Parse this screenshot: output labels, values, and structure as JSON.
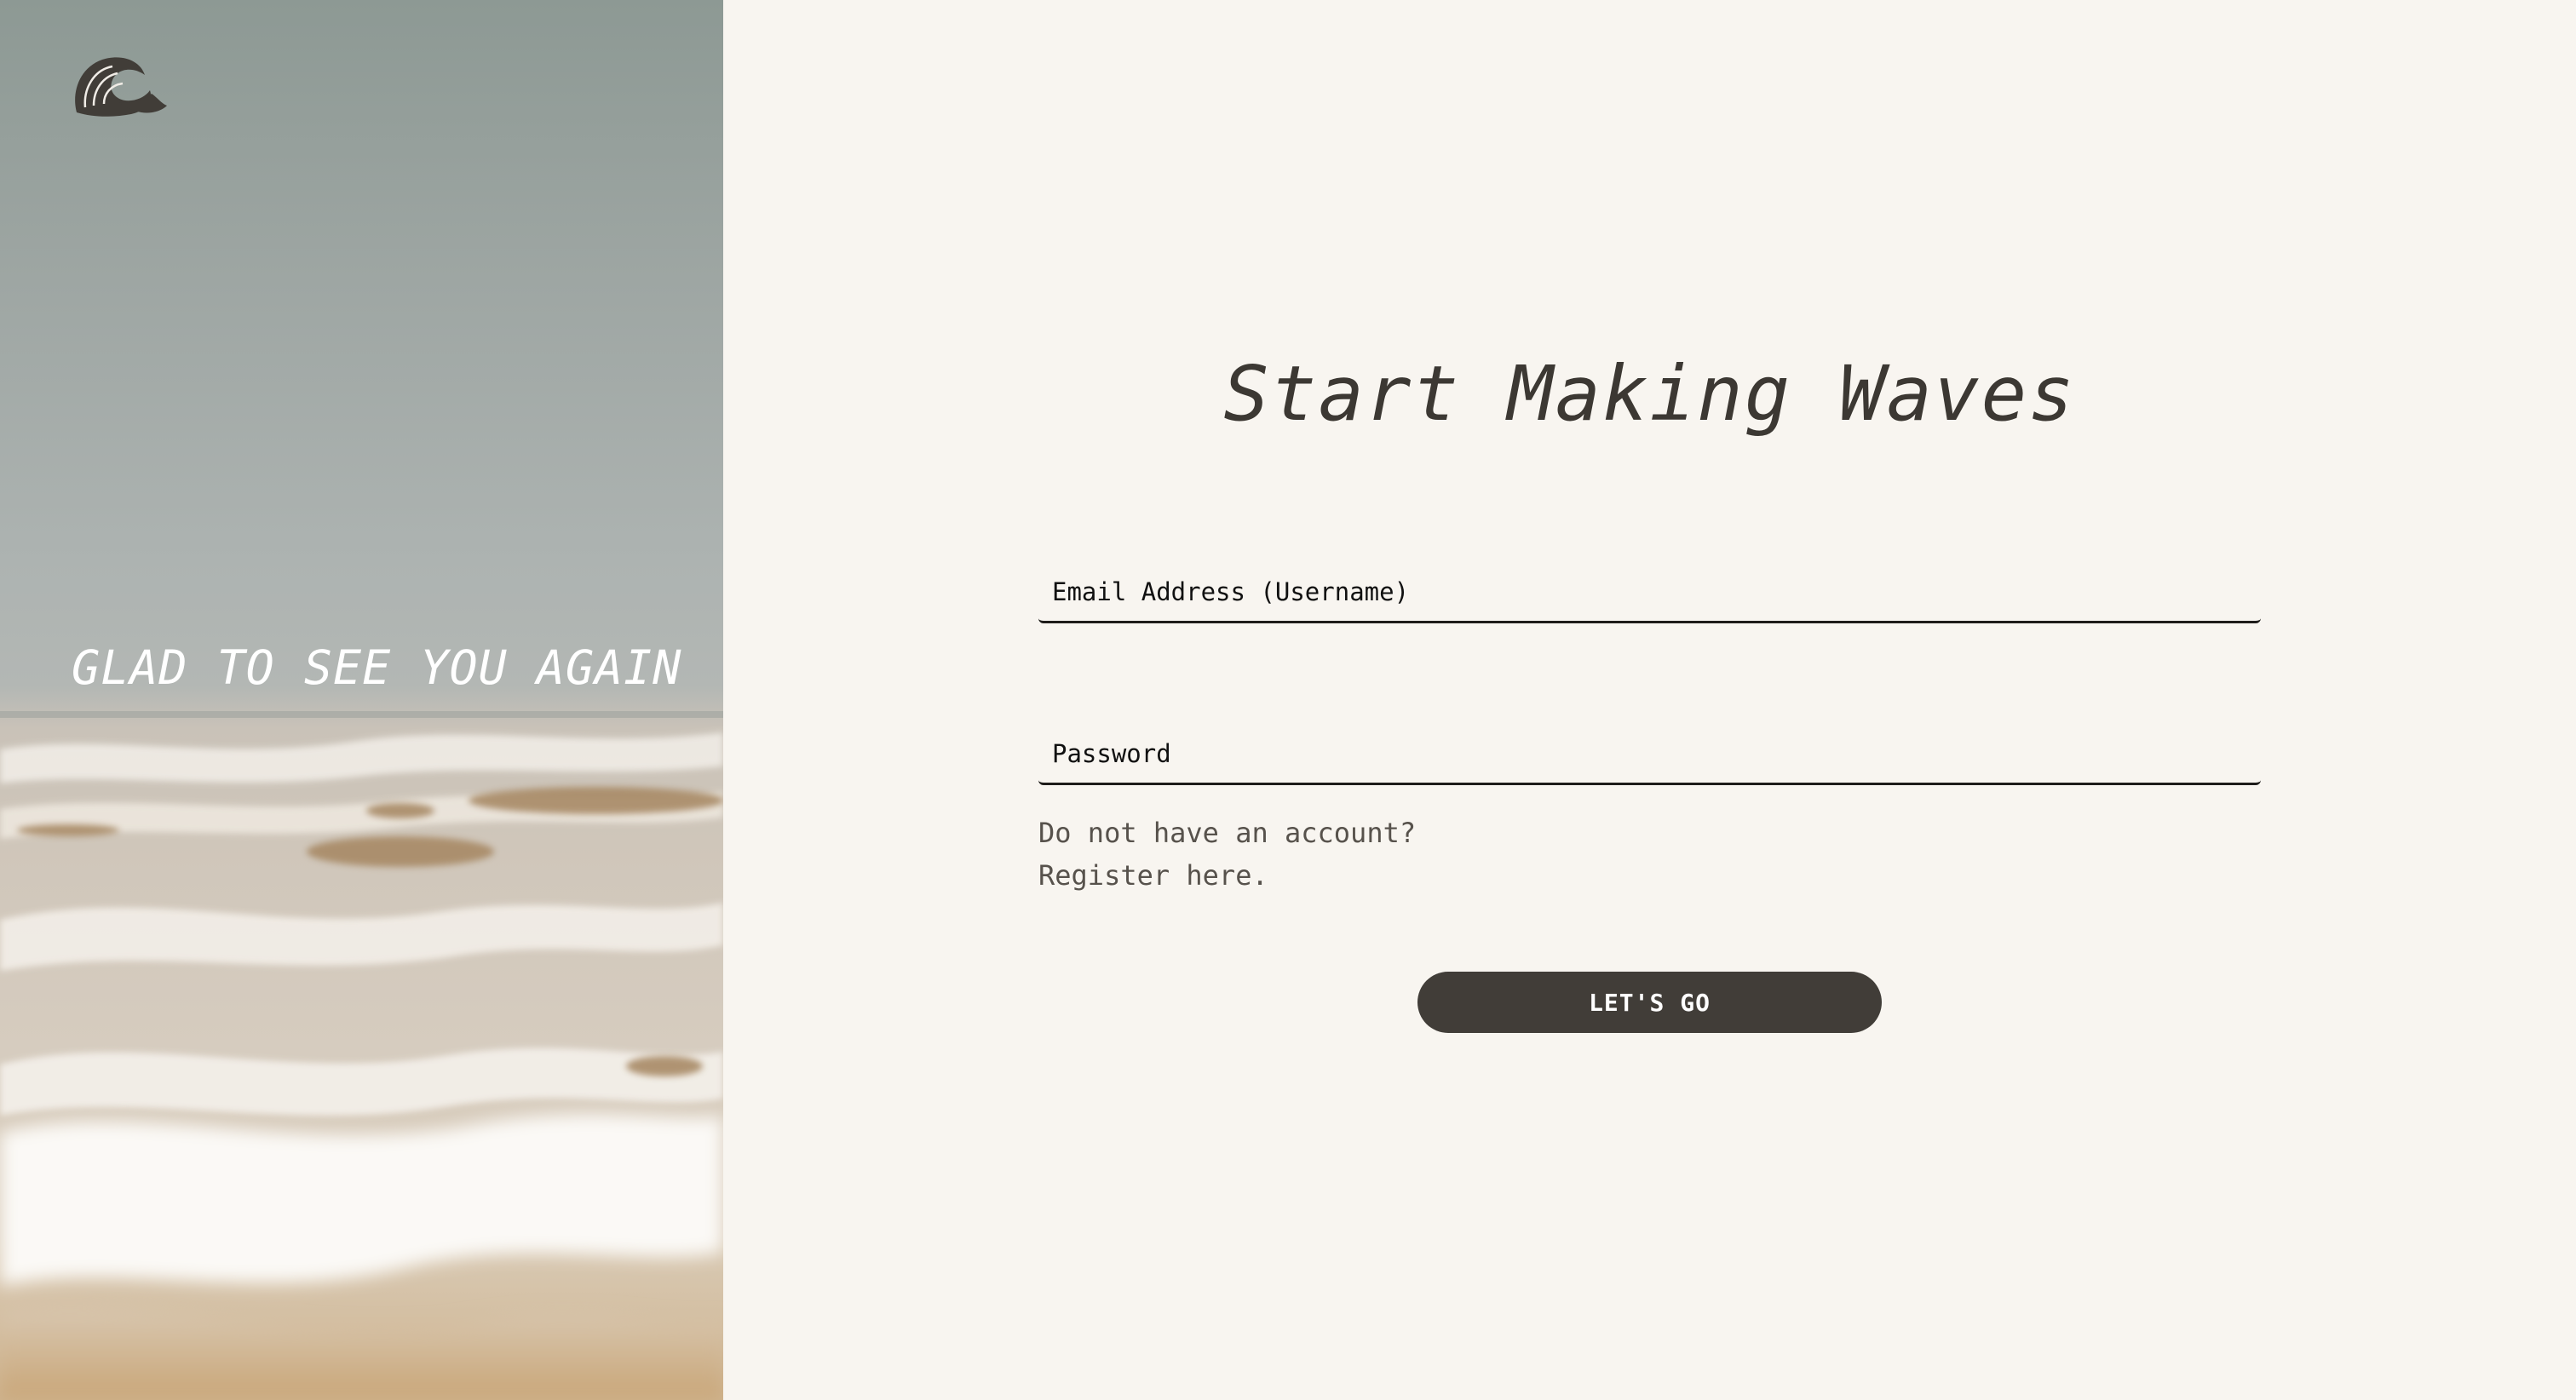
{
  "hero": {
    "tagline": "GLAD TO SEE YOU AGAIN",
    "logo_icon": "wave-icon",
    "image_subject": "ocean-waves-on-rocky-beach"
  },
  "form": {
    "title": "Start Making Waves",
    "email_placeholder": "Email Address (Username)",
    "password_placeholder": "Password",
    "register_line1": "Do not have an account?",
    "register_line2": "Register here.",
    "submit_label": "LET'S GO"
  },
  "colors": {
    "panel_background": "#f8f5f0",
    "heading_text": "#3c3833",
    "button_background": "#413d38",
    "button_text": "#ffffff",
    "field_underline": "#1e1c1a",
    "logo": "#413d38"
  }
}
